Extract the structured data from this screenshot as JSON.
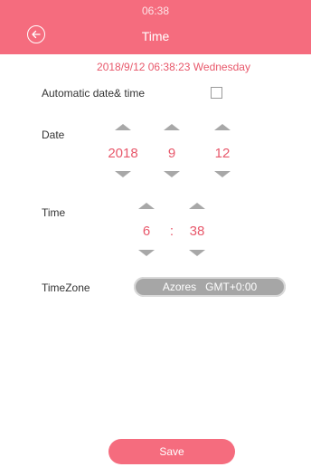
{
  "status_bar": {
    "time": "06:38"
  },
  "header": {
    "title": "Time",
    "back_icon": "back-arrow-circle-icon"
  },
  "current_datetime": "2018/9/12 06:38:23 Wednesday",
  "auto": {
    "label": "Automatic date& time",
    "checked": false
  },
  "date": {
    "label": "Date",
    "year": "2018",
    "month": "9",
    "day": "12"
  },
  "time": {
    "label": "Time",
    "hour": "6",
    "separator": ":",
    "minute": "38"
  },
  "timezone": {
    "label": "TimeZone",
    "value": "Azores   GMT+0:00"
  },
  "save": {
    "label": "Save"
  },
  "colors": {
    "accent": "#f56c7e",
    "accent_text": "#e8586b",
    "arrow": "#a8a8a8",
    "pill": "#a6a6a6"
  }
}
